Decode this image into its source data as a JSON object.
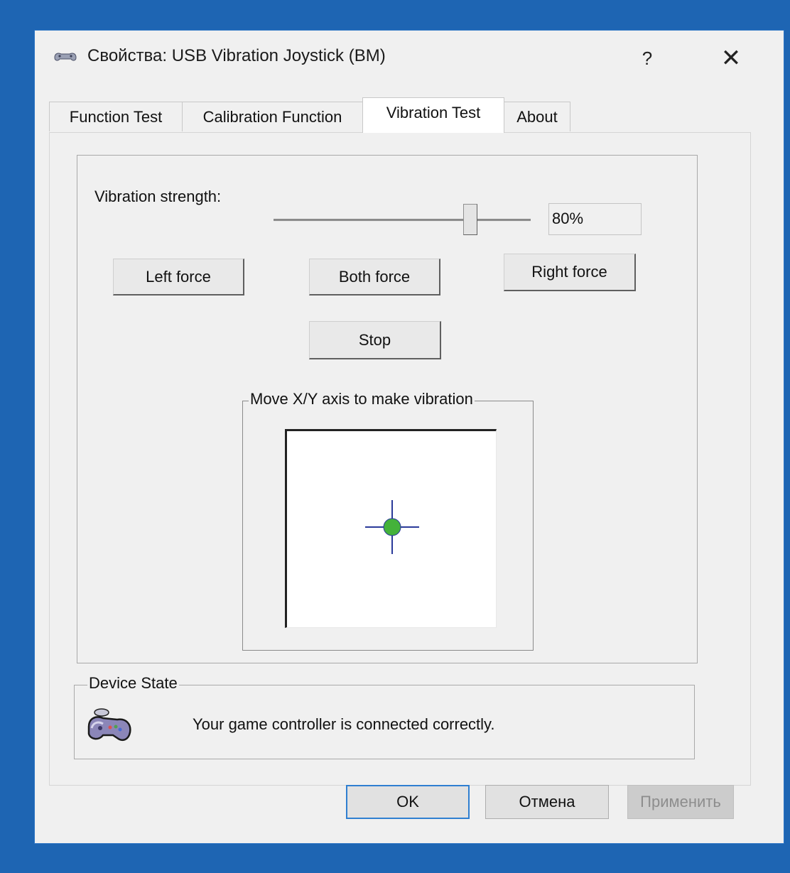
{
  "window": {
    "title": "Свойства: USB Vibration Joystick (BM)",
    "help_label": "?",
    "close_label": "✕"
  },
  "tabs": [
    {
      "label": "Function Test",
      "active": false
    },
    {
      "label": "Calibration Function",
      "active": false
    },
    {
      "label": "Vibration Test",
      "active": true
    },
    {
      "label": "About",
      "active": false
    }
  ],
  "vibration": {
    "strength_label": "Vibration strength:",
    "strength_value": "80%",
    "strength_level": 0.8,
    "left_force_label": "Left force",
    "both_force_label": "Both force",
    "right_force_label": "Right force",
    "stop_label": "Stop",
    "xy_caption": "Move X/Y axis to make vibration",
    "crosshair_color": "#2a3a9a",
    "dot_color": "#44b23a"
  },
  "device_state": {
    "caption": "Device State",
    "message": "Your game controller is connected correctly.",
    "icon": "gamepad-icon"
  },
  "dialog_buttons": {
    "ok_label": "OK",
    "cancel_label": "Отмена",
    "apply_label": "Применить"
  }
}
